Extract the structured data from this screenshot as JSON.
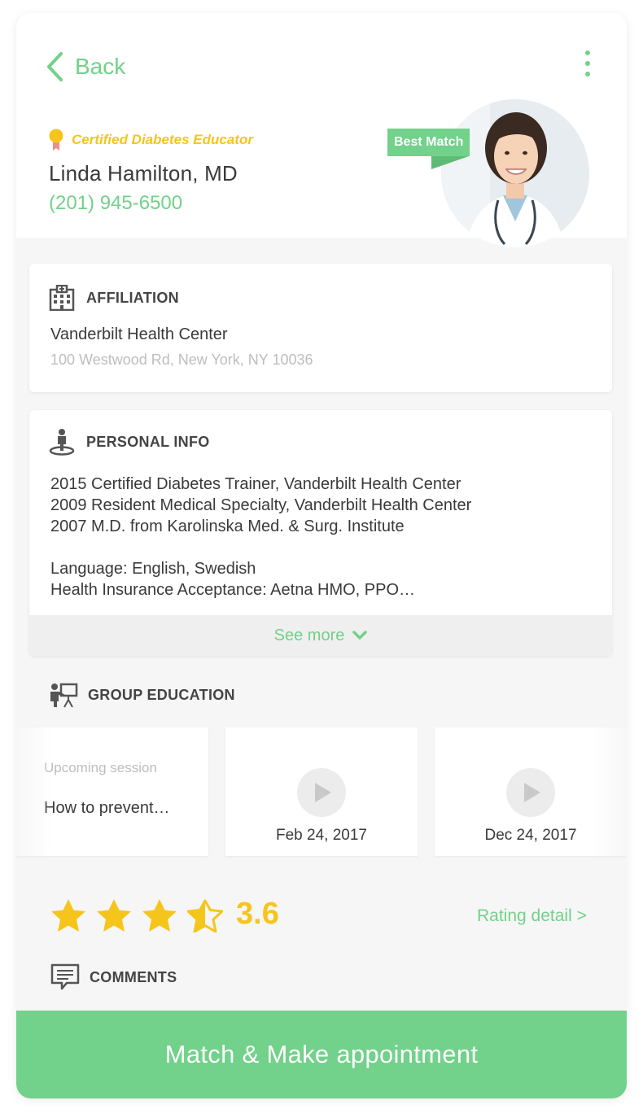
{
  "header": {
    "back_label": "Back",
    "certification": "Certified Diabetes Educator",
    "doctor_name": "Linda Hamilton, MD",
    "phone": "(201) 945-6500",
    "badge": "Best Match",
    "icons": [
      "back-chevron-icon",
      "more-vertical-icon",
      "award-medal-icon"
    ]
  },
  "affiliation": {
    "title": "AFFILIATION",
    "name": "Vanderbilt Health Center",
    "address": "100 Westwood Rd, New York, NY 10036",
    "icon": "hospital-building-icon"
  },
  "personal_info": {
    "title": "PERSONAL INFO",
    "history": [
      "2015  Certified Diabetes Trainer, Vanderbilt Health Center",
      "2009  Resident Medical Specialty, Vanderbilt Health Center",
      "2007  M.D. from Karolinska Med. & Surg. Institute"
    ],
    "language": "Language: English, Swedish",
    "insurance": "Health Insurance Acceptance: Aetna HMO, PPO…",
    "see_more": "See more",
    "icon": "person-pin-icon"
  },
  "group_education": {
    "title": "GROUP EDUCATION",
    "icon": "presenter-icon",
    "sessions": [
      {
        "subtitle": "Upcoming session",
        "title": "How to prevent…"
      },
      {
        "date": "Feb 24, 2017",
        "icon": "play-icon"
      },
      {
        "date": "Dec 24, 2017",
        "icon": "play-icon"
      }
    ]
  },
  "rating": {
    "value": "3.6",
    "detail_label": "Rating detail >",
    "stars_total": 5,
    "stars_filled": 3.6
  },
  "comments": {
    "title": "COMMENTS",
    "icon": "comment-bubble-icon"
  },
  "cta": {
    "label": "Match & Make appointment"
  },
  "colors": {
    "accent_green": "#72d18a",
    "star_yellow": "#f5c51b",
    "muted_text": "#bdbdbd",
    "body_text": "#3a3a3a",
    "background": "#f6f6f6"
  }
}
